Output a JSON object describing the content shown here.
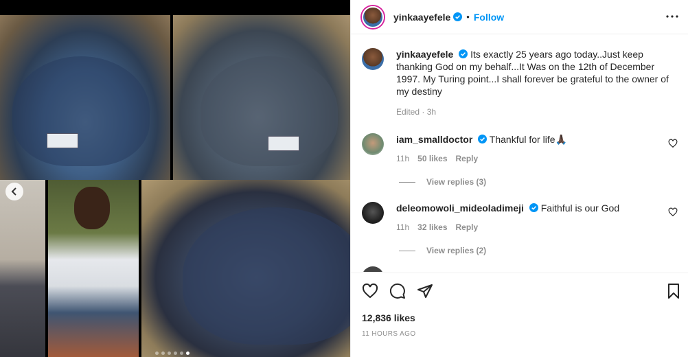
{
  "post": {
    "username": "yinkaayefele",
    "separator": "•",
    "follow_label": "Follow",
    "caption": "Its exactly 25 years ago today..Just keep thanking God on my behalf...It Was on the 12th of December 1997. My Turing point...I shall forever be grateful to the owner of my destiny",
    "caption_meta": "Edited · 3h",
    "likes": "12,836 likes",
    "time_ago": "11 HOURS AGO",
    "carousel": {
      "total_slides": 6,
      "active_slide": 6
    }
  },
  "comments": [
    {
      "username": "iam_smalldoctor",
      "text": "Thankful for life🙏🏿",
      "time": "11h",
      "likes": "50 likes",
      "reply_label": "Reply",
      "view_replies": "View replies (3)"
    },
    {
      "username": "deleomowoli_mideoladimeji",
      "text": "Faithful is our God",
      "time": "11h",
      "likes": "32 likes",
      "reply_label": "Reply",
      "view_replies": "View replies (2)"
    }
  ],
  "colors": {
    "accent": "#0095f6",
    "verified": "#0095f6",
    "muted": "#8e8e8e",
    "text": "#262626"
  },
  "icons": {
    "like": "heart-icon",
    "comment": "comment-icon",
    "share": "send-icon",
    "save": "bookmark-icon",
    "more": "more-options-icon",
    "prev": "chevron-left-icon"
  }
}
